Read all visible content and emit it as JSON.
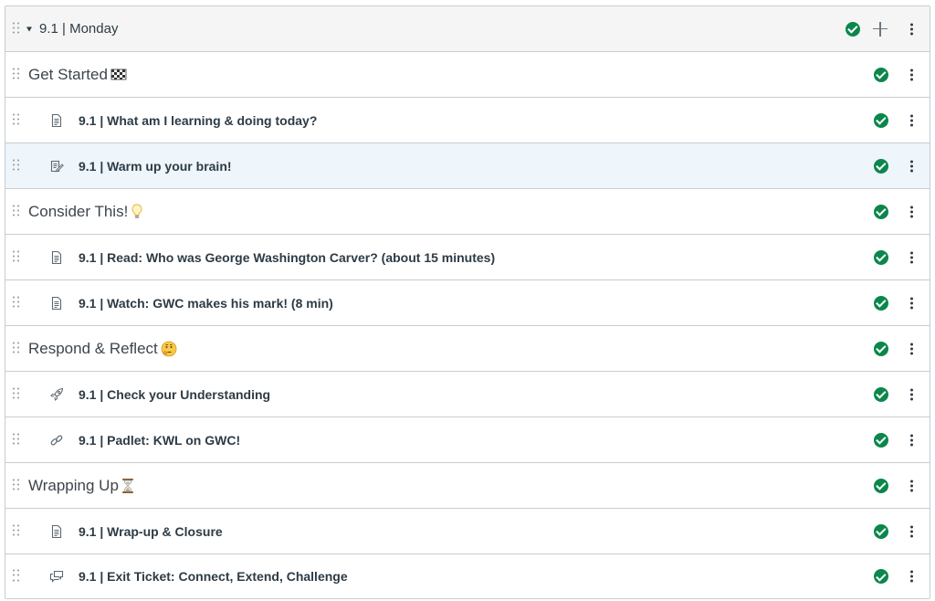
{
  "module": {
    "title": "9.1 | Monday"
  },
  "rows": [
    {
      "kind": "header",
      "label": "Get Started",
      "emoji": "checkered-flag"
    },
    {
      "kind": "item",
      "icon": "page-icon",
      "label": "9.1 | What am I learning & doing today?"
    },
    {
      "kind": "item",
      "icon": "assignment-icon",
      "label": "9.1 | Warm up your brain!",
      "highlight": true
    },
    {
      "kind": "header",
      "label": "Consider This!",
      "emoji": "light-bulb"
    },
    {
      "kind": "item",
      "icon": "page-icon",
      "label": "9.1 | Read: Who was George Washington Carver? (about 15 minutes)"
    },
    {
      "kind": "item",
      "icon": "page-icon",
      "label": "9.1 | Watch: GWC makes his mark! (8 min)"
    },
    {
      "kind": "header",
      "label": "Respond & Reflect",
      "emoji": "thinking-face"
    },
    {
      "kind": "item",
      "icon": "quiz-rocket-icon",
      "label": "9.1 | Check your Understanding"
    },
    {
      "kind": "item",
      "icon": "link-icon",
      "label": "9.1 | Padlet: KWL on GWC!"
    },
    {
      "kind": "header",
      "label": "Wrapping Up",
      "emoji": "hourglass"
    },
    {
      "kind": "item",
      "icon": "page-icon",
      "label": "9.1 | Wrap-up & Closure"
    },
    {
      "kind": "item",
      "icon": "discussion-icon",
      "label": "9.1 | Exit Ticket: Connect, Extend, Challenge"
    }
  ],
  "colors": {
    "published_green": "#0b874b",
    "border": "#c7cdd1",
    "highlight_row": "#eef5fb",
    "text": "#2d3b45"
  }
}
